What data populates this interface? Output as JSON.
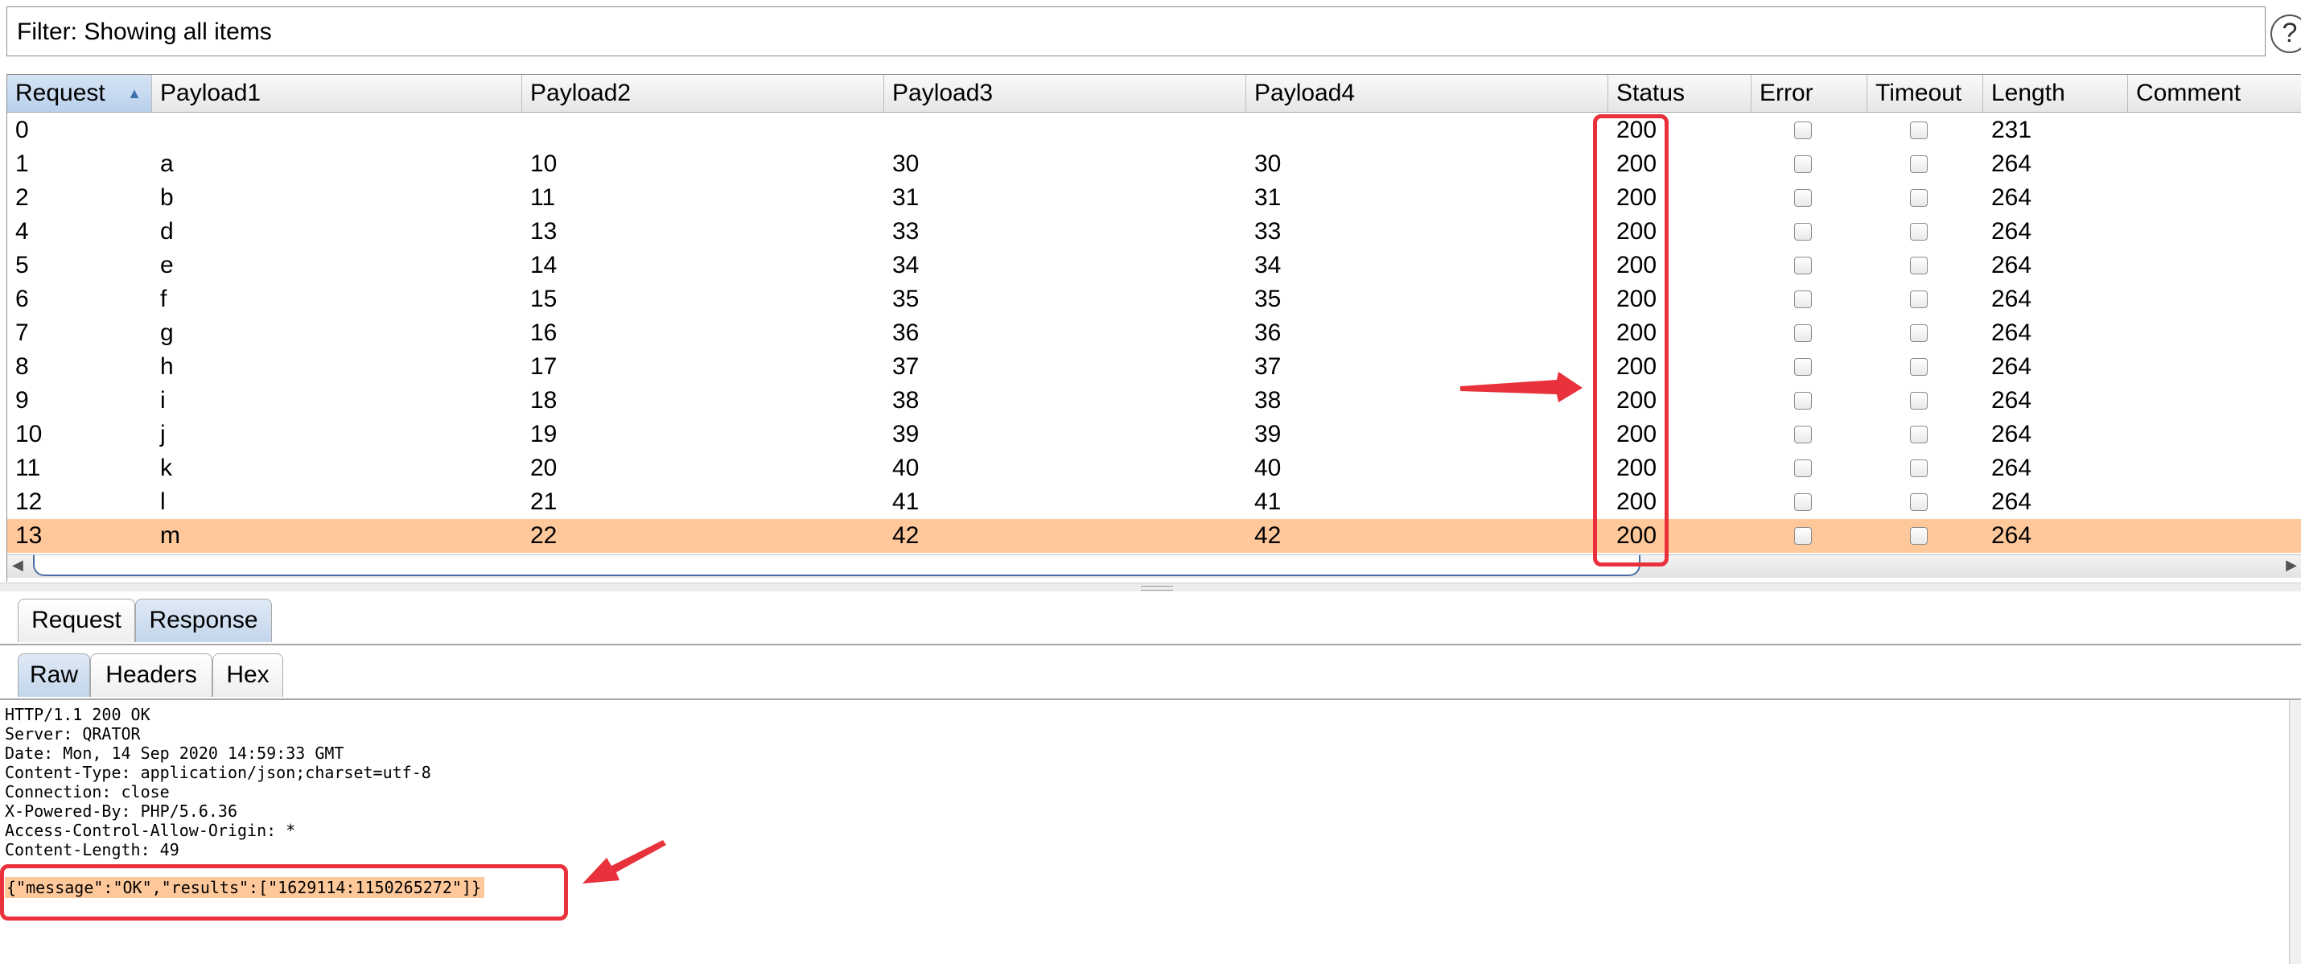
{
  "filter": {
    "text": "Filter: Showing all items",
    "help_label": "?"
  },
  "table": {
    "columns": [
      {
        "label": "Request",
        "sorted": true
      },
      {
        "label": "Payload1"
      },
      {
        "label": "Payload2"
      },
      {
        "label": "Payload3"
      },
      {
        "label": "Payload4"
      },
      {
        "label": "Status"
      },
      {
        "label": "Error"
      },
      {
        "label": "Timeout"
      },
      {
        "label": "Length"
      },
      {
        "label": "Comment"
      }
    ],
    "rows": [
      {
        "request": "0",
        "p1": "",
        "p2": "",
        "p3": "",
        "p4": "",
        "status": "200",
        "length": "231"
      },
      {
        "request": "1",
        "p1": "a",
        "p2": "10",
        "p3": "30",
        "p4": "30",
        "status": "200",
        "length": "264"
      },
      {
        "request": "2",
        "p1": "b",
        "p2": "11",
        "p3": "31",
        "p4": "31",
        "status": "200",
        "length": "264"
      },
      {
        "request": "4",
        "p1": "d",
        "p2": "13",
        "p3": "33",
        "p4": "33",
        "status": "200",
        "length": "264"
      },
      {
        "request": "5",
        "p1": "e",
        "p2": "14",
        "p3": "34",
        "p4": "34",
        "status": "200",
        "length": "264"
      },
      {
        "request": "6",
        "p1": "f",
        "p2": "15",
        "p3": "35",
        "p4": "35",
        "status": "200",
        "length": "264"
      },
      {
        "request": "7",
        "p1": "g",
        "p2": "16",
        "p3": "36",
        "p4": "36",
        "status": "200",
        "length": "264"
      },
      {
        "request": "8",
        "p1": "h",
        "p2": "17",
        "p3": "37",
        "p4": "37",
        "status": "200",
        "length": "264"
      },
      {
        "request": "9",
        "p1": "i",
        "p2": "18",
        "p3": "38",
        "p4": "38",
        "status": "200",
        "length": "264"
      },
      {
        "request": "10",
        "p1": "j",
        "p2": "19",
        "p3": "39",
        "p4": "39",
        "status": "200",
        "length": "264"
      },
      {
        "request": "11",
        "p1": "k",
        "p2": "20",
        "p3": "40",
        "p4": "40",
        "status": "200",
        "length": "264"
      },
      {
        "request": "12",
        "p1": "l",
        "p2": "21",
        "p3": "41",
        "p4": "41",
        "status": "200",
        "length": "264"
      },
      {
        "request": "13",
        "p1": "m",
        "p2": "22",
        "p3": "42",
        "p4": "42",
        "status": "200",
        "length": "264",
        "selected": true
      }
    ]
  },
  "tabs_top": [
    {
      "label": "Request"
    },
    {
      "label": "Response",
      "active": true
    }
  ],
  "tabs_sub": [
    {
      "label": "Raw",
      "active": true
    },
    {
      "label": "Headers"
    },
    {
      "label": "Hex"
    }
  ],
  "response": {
    "lines": [
      "HTTP/1.1 200 OK",
      "Server: QRATOR",
      "Date: Mon, 14 Sep 2020 14:59:33 GMT",
      "Content-Type: application/json;charset=utf-8",
      "Connection: close",
      "X-Powered-By: PHP/5.6.36",
      "Access-Control-Allow-Origin: *",
      "Content-Length: 49"
    ],
    "body": "{\"message\":\"OK\",\"results\":[\"1629114:1150265272\"]}"
  },
  "colors": {
    "selected_row": "#ffc89a",
    "annotation": "#e8313a",
    "scroll_thumb": "#4a6fa5"
  }
}
